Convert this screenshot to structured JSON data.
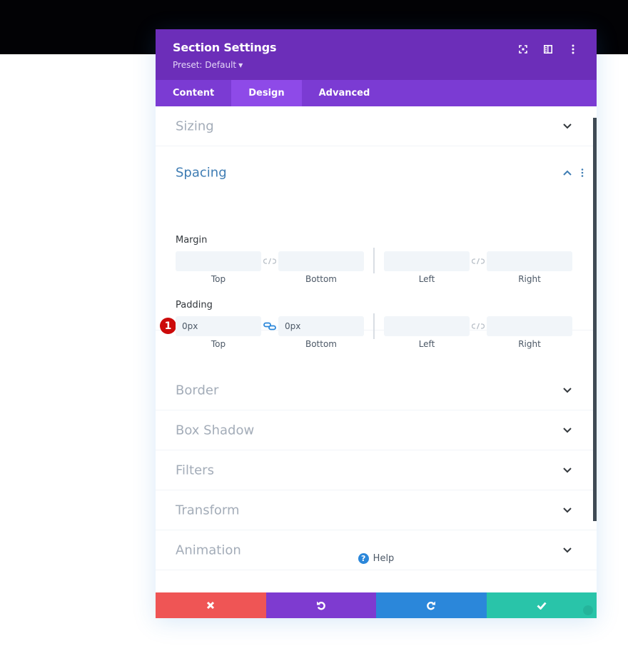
{
  "modal": {
    "title": "Section Settings",
    "preset": "Preset: Default",
    "header_icons": [
      "fullscreen-icon",
      "split-view-icon",
      "more-options-icon"
    ]
  },
  "tabs": [
    {
      "label": "Content",
      "active": false
    },
    {
      "label": "Design",
      "active": true
    },
    {
      "label": "Advanced",
      "active": false
    }
  ],
  "sections": {
    "sizing": "Sizing",
    "spacing": "Spacing",
    "border": "Border",
    "box_shadow": "Box Shadow",
    "filters": "Filters",
    "transform": "Transform",
    "animation": "Animation"
  },
  "spacing": {
    "margin": {
      "label": "Margin",
      "top": {
        "label": "Top",
        "value": ""
      },
      "bottom": {
        "label": "Bottom",
        "value": ""
      },
      "left": {
        "label": "Left",
        "value": ""
      },
      "right": {
        "label": "Right",
        "value": ""
      },
      "top_bottom_linked": false,
      "left_right_linked": false
    },
    "padding": {
      "label": "Padding",
      "top": {
        "label": "Top",
        "value": "0px"
      },
      "bottom": {
        "label": "Bottom",
        "value": "0px"
      },
      "left": {
        "label": "Left",
        "value": ""
      },
      "right": {
        "label": "Right",
        "value": ""
      },
      "top_bottom_linked": true,
      "left_right_linked": false
    },
    "annotation_badge": "1"
  },
  "help": {
    "label": "Help",
    "icon": "?"
  },
  "footer": {
    "cancel": "cancel-icon",
    "undo": "undo-icon",
    "redo": "redo-icon",
    "save": "save-check-icon"
  },
  "colors": {
    "header": "#6c2eb9",
    "tabs": "#7b3bd3",
    "tab_active": "#8e4ae8",
    "spacing_title": "#3e7cb3",
    "cancel": "#ef5555",
    "undo": "#7e3bd0",
    "redo": "#2b87da",
    "save": "#29c4a9",
    "badge": "#cc0a0a"
  }
}
